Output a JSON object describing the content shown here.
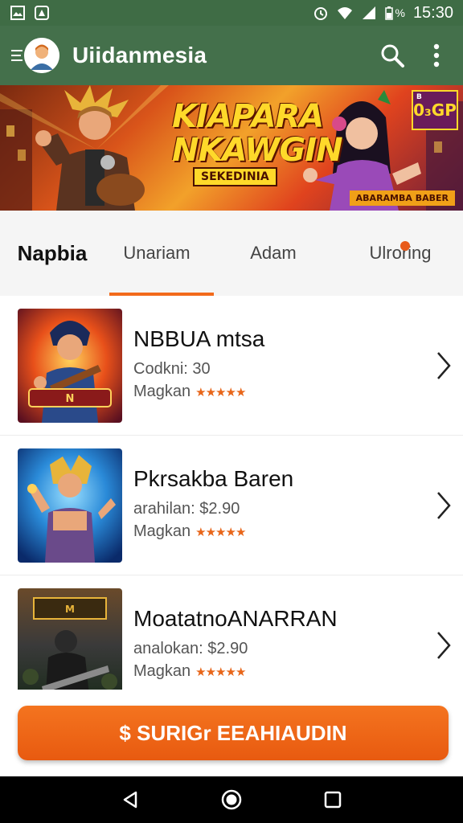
{
  "status_bar": {
    "battery_text": "%",
    "time": "15:30",
    "icons": [
      "gallery-icon",
      "drive-icon",
      "alarm-icon",
      "wifi-icon",
      "signal-icon",
      "battery-icon"
    ]
  },
  "app_bar": {
    "title": "Uiidanmesia",
    "icons": [
      "menu-icon",
      "avatar",
      "search-icon",
      "more-vert-icon"
    ]
  },
  "banner": {
    "title_line1": "KIAPARA",
    "title_line2": "NKAWGIN",
    "tag": "SEKEDINIA",
    "badge": "0₃GP",
    "badge_small": "B",
    "ribbon": "ABARAMBA BABER"
  },
  "tabs": [
    {
      "label": "Napbia",
      "active": false
    },
    {
      "label": "Unariam",
      "active": true
    },
    {
      "label": "Adam",
      "active": false
    },
    {
      "label": "Ulroring",
      "active": false,
      "has_dot": true
    }
  ],
  "list": [
    {
      "title": "NBBUA mtsa",
      "price": "Codkni: 30",
      "rating_label": "Magkan",
      "stars": "★★★★★"
    },
    {
      "title": "Pkrsakba Baren",
      "price": "arahilan:  $2.90",
      "rating_label": "Magkan",
      "stars": "★★★★★"
    },
    {
      "title": "MoatatnoANARRAN",
      "price": "analokan:  $2.90",
      "rating_label": "Magkan",
      "stars": "★★★★★"
    }
  ],
  "cta": {
    "label": "$ SURIGr EEAHIAUDIN"
  },
  "nav_bar": {
    "icons": [
      "back-icon",
      "home-icon",
      "recents-icon"
    ]
  },
  "colors": {
    "status_bar": "#3f6c45",
    "app_bar": "#44704b",
    "accent": "#f26a1b",
    "cta": "#e85a10"
  }
}
